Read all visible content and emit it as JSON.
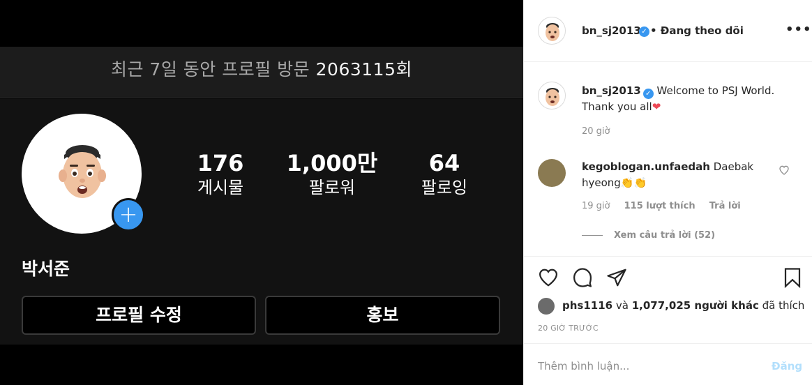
{
  "profile_screen": {
    "visits_prefix": "최근 7일 동안 프로필 방문",
    "visits_count": "2063115",
    "visits_suffix": "회",
    "stats": [
      {
        "number": "176",
        "label": "게시물"
      },
      {
        "number": "1,000만",
        "label": "팔로워"
      },
      {
        "number": "64",
        "label": "팔로잉"
      }
    ],
    "plus_symbol": "+",
    "name": "박서준",
    "edit_profile_label": "프로필 수정",
    "promote_label": "홍보"
  },
  "post": {
    "author": "bn_sj2013",
    "verified_mark": "✓",
    "follow_status": "• Đang theo dõi",
    "more_symbol": "•••",
    "caption": "Welcome to PSJ World. Thank you all",
    "caption_emoji": "❤",
    "caption_time": "20 giờ",
    "comment": {
      "user": "kegoblogan.unfaedah",
      "text": "Daebak hyeong",
      "emoji": "👏👏",
      "time": "19 giờ",
      "likes": "115 lượt thích",
      "reply_label": "Trả lời",
      "view_replies": "Xem câu trả lời (52)"
    },
    "liked_by_user": "phs1116",
    "liked_by_and": "và",
    "liked_by_others": "1,077,025 người khác",
    "liked_by_suffix": "đã thích",
    "posted_time": "20 GIỜ TRƯỚC",
    "comment_placeholder": "Thêm bình luận...",
    "post_button": "Đăng"
  },
  "colors": {
    "accent": "#3897f0",
    "post_button_disabled": "#b2dffc",
    "heart_emoji": "#ed4956"
  }
}
